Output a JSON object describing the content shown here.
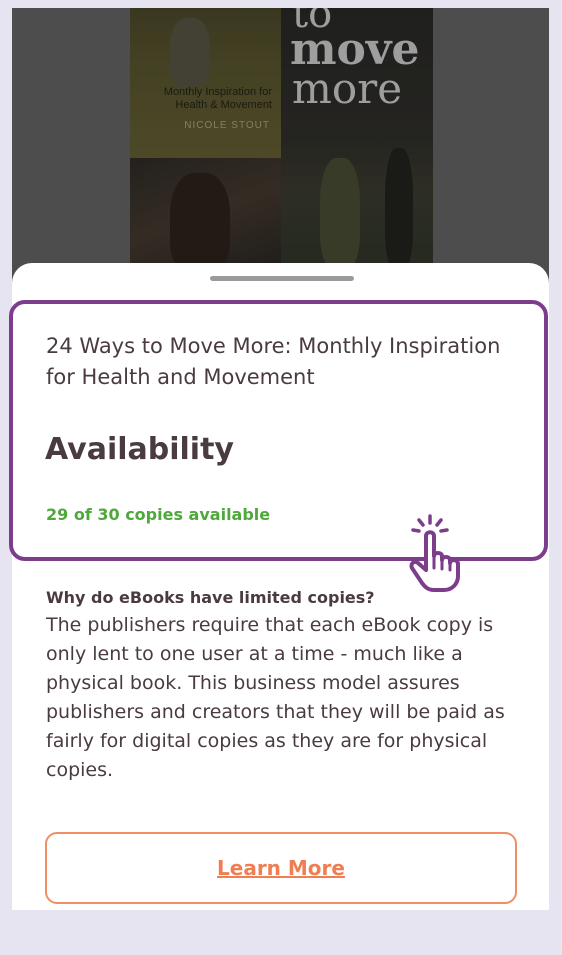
{
  "cover": {
    "title_words": [
      "to",
      "move",
      "more"
    ],
    "subtitle": "Monthly Inspiration for Health & Movement",
    "author": "NICOLE STOUT"
  },
  "sheet": {
    "book_title": "24 Ways to Move More: Monthly Inspiration for Health and Movement",
    "availability_heading": "Availability",
    "copies_text": "29 of 30 copies available",
    "faq_question": "Why do eBooks have limited copies?",
    "faq_answer": "The publishers require that each eBook copy is only lent to one user at a time - much like a physical book. This business model assures publishers and creators that they will be paid as fairly for digital copies as they are for physical copies.",
    "learn_more_label": "Learn More"
  },
  "colors": {
    "page_background": "#e7e4f1",
    "highlight_border": "#7d3d8d",
    "available_green": "#4fa83b",
    "accent_orange": "#ef7f52",
    "text_dark": "#4a3b40"
  },
  "icons": {
    "pointer": "hand-pointer-click-icon"
  }
}
